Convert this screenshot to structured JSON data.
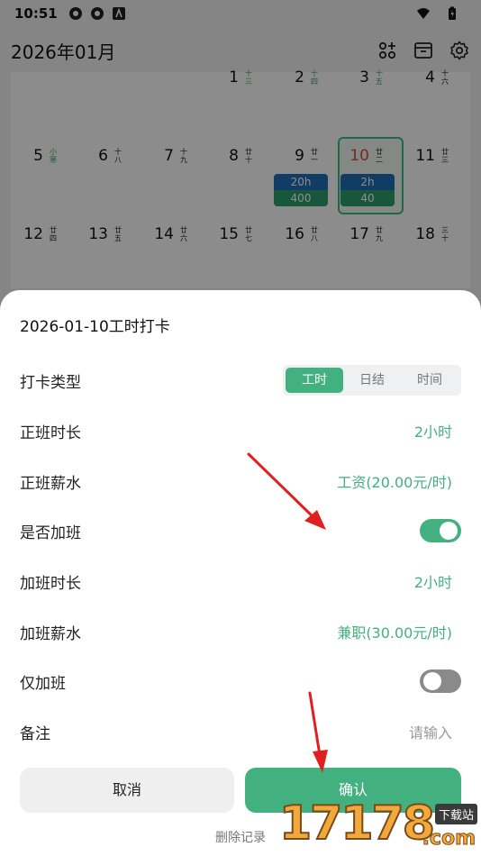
{
  "status_bar": {
    "time": "10:51"
  },
  "header": {
    "month": "2026年01月"
  },
  "calendar": {
    "weeks": [
      [
        {
          "day": "1",
          "lunar": "十三"
        },
        {
          "day": "2",
          "lunar": "十四"
        },
        {
          "day": "3",
          "lunar": "十五"
        },
        {
          "day": "4",
          "lunar": "十六"
        }
      ],
      [
        {
          "day": "5",
          "lunar": "小寒"
        },
        {
          "day": "6",
          "lunar": "十八"
        },
        {
          "day": "7",
          "lunar": "十九"
        },
        {
          "day": "8",
          "lunar": "廿十"
        },
        {
          "day": "9",
          "lunar": "廿一",
          "hours": "20h",
          "pay": "400"
        },
        {
          "day": "10",
          "lunar": "廿二",
          "hours": "2h",
          "pay": "40"
        },
        {
          "day": "11",
          "lunar": "廿三"
        }
      ],
      [
        {
          "day": "12",
          "lunar": "廿四"
        },
        {
          "day": "13",
          "lunar": "廿五"
        },
        {
          "day": "14",
          "lunar": "廿六"
        },
        {
          "day": "15",
          "lunar": "廿七"
        },
        {
          "day": "16",
          "lunar": "廿八"
        },
        {
          "day": "17",
          "lunar": "廿九"
        },
        {
          "day": "18",
          "lunar": "三十"
        }
      ]
    ]
  },
  "sheet": {
    "title": "2026-01-10工时打卡",
    "punch_type": {
      "label": "打卡类型",
      "options": [
        "工时",
        "日结",
        "时间"
      ],
      "selected": "工时"
    },
    "regular_hours": {
      "label": "正班时长",
      "value": "2小时"
    },
    "regular_pay": {
      "label": "正班薪水",
      "value": "工资(20.00元/时)"
    },
    "overtime": {
      "label": "是否加班",
      "on": true
    },
    "overtime_hours": {
      "label": "加班时长",
      "value": "2小时"
    },
    "overtime_pay": {
      "label": "加班薪水",
      "value": "兼职(30.00元/时)"
    },
    "overtime_only": {
      "label": "仅加班",
      "on": false
    },
    "note": {
      "label": "备注",
      "placeholder": "请输入"
    },
    "cancel_label": "取消",
    "confirm_label": "确认",
    "delete_label": "删除记录"
  },
  "watermark": {
    "brand": "17178",
    "tag": "下载站",
    "domain": ".com"
  },
  "colors": {
    "accent": "#43b07f",
    "today_red": "#e04a3a",
    "hours_blue": "#2070b8",
    "arrow_red": "#e02020"
  }
}
